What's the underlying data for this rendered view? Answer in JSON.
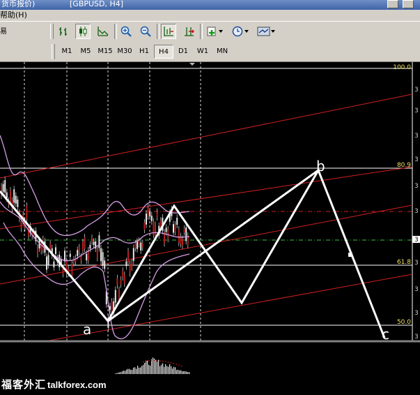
{
  "window": {
    "title_left": "货币报价)",
    "title_right": "[GBPUSD, H4]"
  },
  "menu": {
    "help_label": "帮助(H)"
  },
  "toolbar": {
    "stub_label": "易",
    "icons": [
      "bar-chart-icon",
      "candlestick-icon",
      "line-chart-icon",
      "zoom-in-icon",
      "zoom-out-icon",
      "chart-shift-icon",
      "autoscroll-icon",
      "indicators-icon",
      "periods-clock-icon",
      "templates-icon"
    ]
  },
  "timeframes": [
    "M1",
    "M5",
    "M15",
    "M30",
    "H1",
    "H4",
    "D1",
    "W1",
    "MN"
  ],
  "active_timeframe": "H4",
  "fibonacci": {
    "levels": [
      {
        "label": "100.0",
        "color": "#f0e060"
      },
      {
        "label": "80.9",
        "color": "#f0e060"
      },
      {
        "label": "61.8",
        "color": "#f0e060"
      },
      {
        "label": "50.0",
        "color": "#f0e060"
      }
    ]
  },
  "wave_labels": {
    "a": "a",
    "b": "b",
    "c": "c"
  },
  "colors": {
    "background": "#000000",
    "channel": "#d02020",
    "bollinger": "#d8a0e8",
    "candles": "#c8c8c8",
    "wave": "#ffffff",
    "fib": "#f0e060",
    "price_dashed": "#d02020",
    "price_green": "#40c040"
  },
  "watermark": {
    "chinese": "福客外汇",
    "site": "talkforex.com"
  }
}
